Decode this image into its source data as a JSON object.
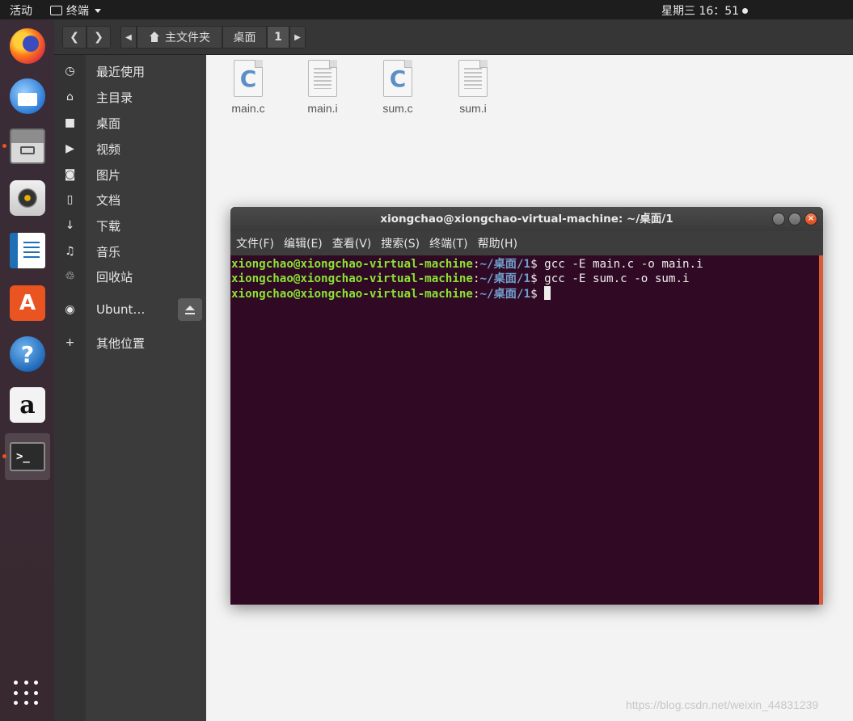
{
  "topbar": {
    "activities": "活动",
    "app_menu_label": "终端",
    "clock": "星期三 16：51"
  },
  "dock": {
    "items": [
      {
        "icon": "firefox-icon",
        "running": false
      },
      {
        "icon": "thunderbird-icon",
        "running": false
      },
      {
        "icon": "files-icon",
        "running": true
      },
      {
        "icon": "rhythmbox-icon",
        "running": false
      },
      {
        "icon": "libreoffice-writer-icon",
        "running": false
      },
      {
        "icon": "ubuntu-software-icon",
        "running": false
      },
      {
        "icon": "help-icon",
        "running": false
      },
      {
        "icon": "amazon-icon",
        "running": false
      },
      {
        "icon": "terminal-icon",
        "running": true,
        "active": true
      }
    ],
    "software_glyph": "A",
    "help_glyph": "?",
    "amazon_glyph": "a",
    "terminal_glyph": ">_"
  },
  "file_manager": {
    "path": {
      "home_label": "主文件夹",
      "desktop_label": "桌面",
      "current_label": "1"
    },
    "sidebar": {
      "items": [
        {
          "label": "最近使用",
          "icon": "clock-icon",
          "glyph": "◷"
        },
        {
          "label": "主目录",
          "icon": "home-icon",
          "glyph": "⌂"
        },
        {
          "label": "桌面",
          "icon": "folder-icon",
          "glyph": "■"
        },
        {
          "label": "视频",
          "icon": "video-icon",
          "glyph": "▶"
        },
        {
          "label": "图片",
          "icon": "camera-icon",
          "glyph": "◙"
        },
        {
          "label": "文档",
          "icon": "document-icon",
          "glyph": "▯"
        },
        {
          "label": "下载",
          "icon": "download-icon",
          "glyph": "↓"
        },
        {
          "label": "音乐",
          "icon": "music-icon",
          "glyph": "♫"
        },
        {
          "label": "回收站",
          "icon": "trash-icon",
          "glyph": "♲"
        },
        {
          "label": "Ubunt…",
          "icon": "disc-icon",
          "glyph": "◉"
        },
        {
          "label": "其他位置",
          "icon": "plus-icon",
          "glyph": "+"
        }
      ]
    },
    "files": [
      {
        "name": "main.c",
        "type": "c"
      },
      {
        "name": "main.i",
        "type": "i"
      },
      {
        "name": "sum.c",
        "type": "c"
      },
      {
        "name": "sum.i",
        "type": "i"
      }
    ],
    "c_glyph": "C"
  },
  "terminal": {
    "title": "xiongchao@xiongchao-virtual-machine: ~/桌面/1",
    "menu": [
      "文件(F)",
      "编辑(E)",
      "查看(V)",
      "搜索(S)",
      "终端(T)",
      "帮助(H)"
    ],
    "lines": [
      {
        "user": "xiongchao@xiongchao-virtual-machine",
        "path": "~/桌面/1",
        "prompt": "$",
        "command": "gcc -E main.c -o main.i"
      },
      {
        "user": "xiongchao@xiongchao-virtual-machine",
        "path": "~/桌面/1",
        "prompt": "$",
        "command": "gcc -E sum.c -o sum.i"
      },
      {
        "user": "xiongchao@xiongchao-virtual-machine",
        "path": "~/桌面/1",
        "prompt": "$",
        "command": ""
      }
    ],
    "close_glyph": "×"
  },
  "watermark": "https://blog.csdn.net/weixin_44831239",
  "colors": {
    "accent": "#e95420",
    "terminal_bg": "#300a24",
    "prompt_user": "#8ae234",
    "prompt_path": "#729fcf"
  }
}
